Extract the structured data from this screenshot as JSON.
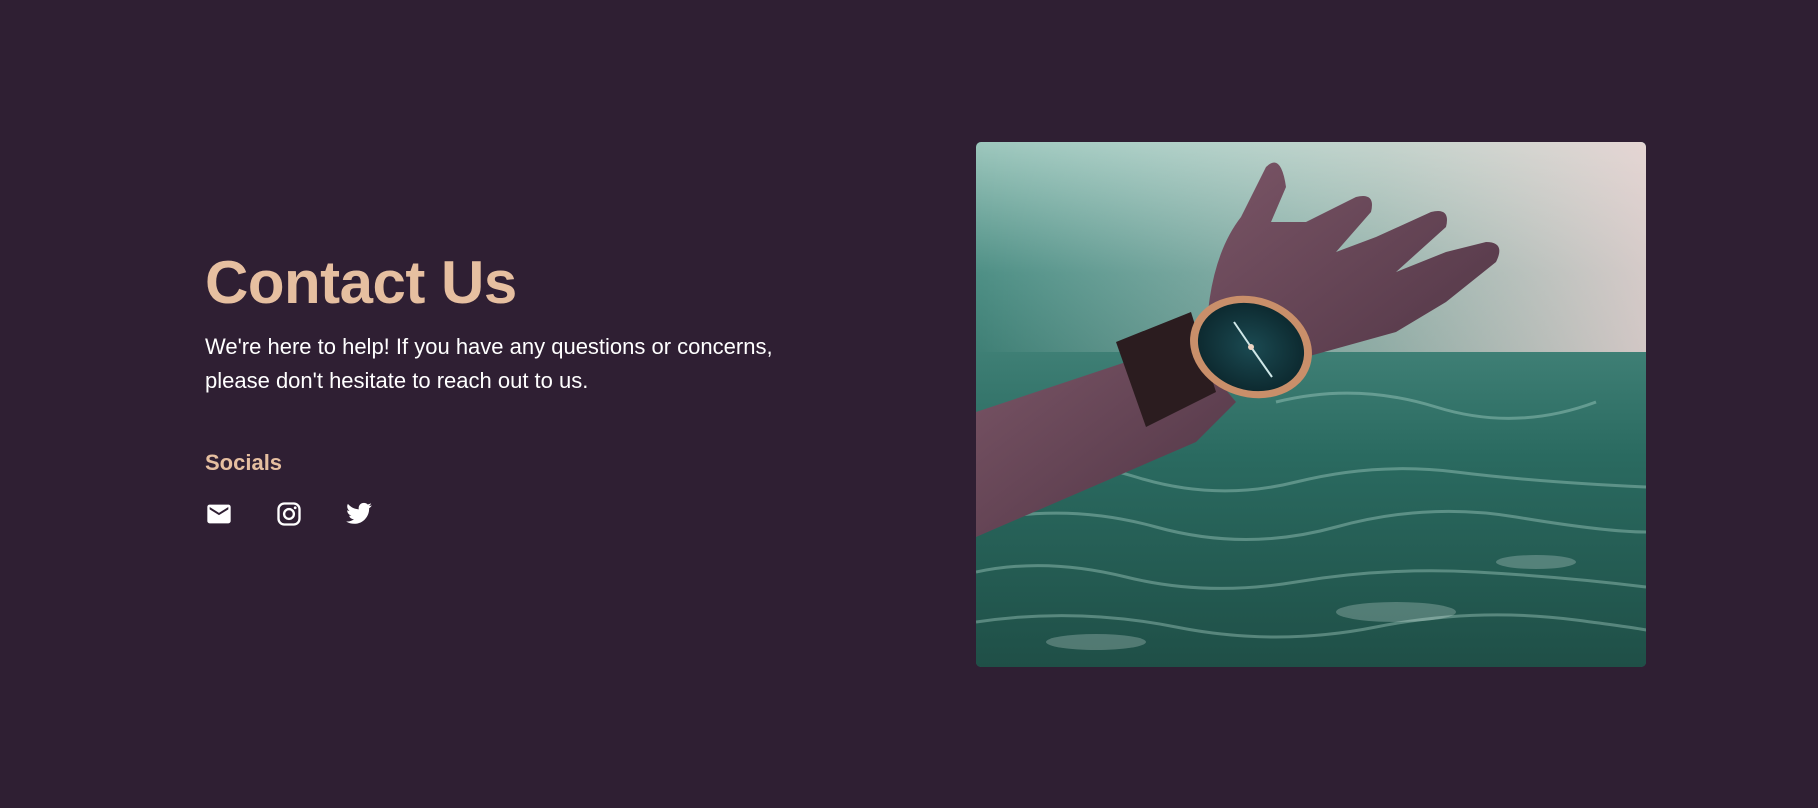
{
  "contact": {
    "title": "Contact Us",
    "description": "We're here to help! If you have any questions or concerns, please don't hesitate to reach out to us.",
    "socials_heading": "Socials",
    "socials": [
      {
        "icon": "mail-icon"
      },
      {
        "icon": "instagram-icon"
      },
      {
        "icon": "twitter-icon"
      }
    ]
  },
  "image": {
    "description_icon": "photo-hand-with-watch-in-water"
  },
  "colors": {
    "background": "#2f1f33",
    "accent": "#e6bfa0",
    "text": "#ffffff"
  }
}
